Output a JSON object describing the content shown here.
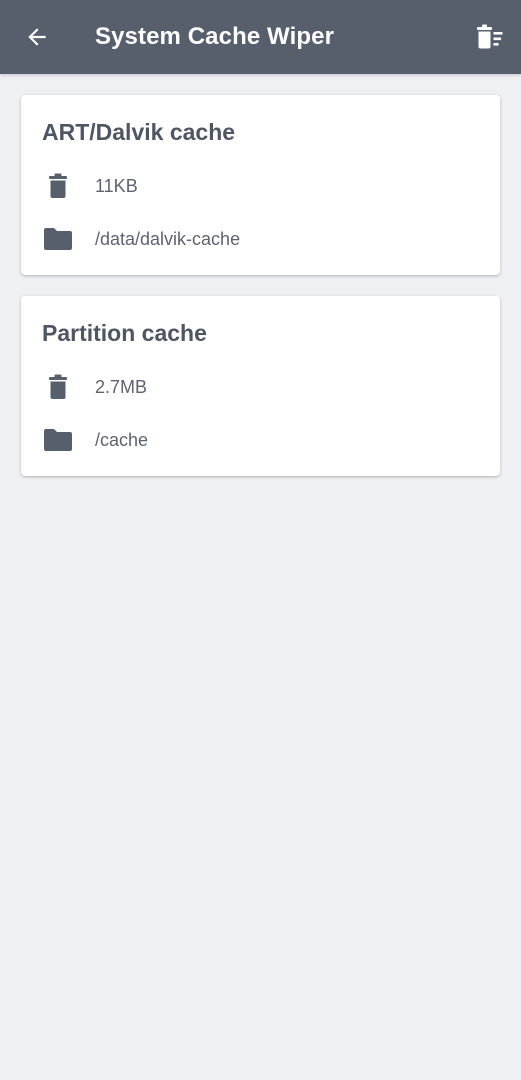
{
  "appbar": {
    "title": "System Cache Wiper",
    "back_icon": "arrow-back-icon",
    "action_icon": "delete-sweep-icon",
    "background": "#575f6c"
  },
  "caches": [
    {
      "title": "ART/Dalvik cache",
      "size": "11KB",
      "path": "/data/dalvik-cache"
    },
    {
      "title": "Partition cache",
      "size": "2.7MB",
      "path": "/cache"
    }
  ],
  "icons": {
    "size": "trash-icon",
    "path": "folder-icon"
  },
  "colors": {
    "background": "#eff0f4",
    "card": "#ffffff",
    "icon": "#575f6c",
    "title_text": "#4f5663"
  }
}
